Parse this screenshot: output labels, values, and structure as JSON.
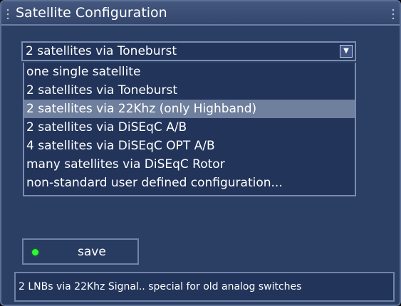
{
  "window": {
    "title": "Satellite Configuration"
  },
  "combo": {
    "selected_value": "2 satellites via Toneburst",
    "dropdown_icon": "triangle-down-icon",
    "options": [
      {
        "label": "one single satellite"
      },
      {
        "label": "2 satellites via Toneburst"
      },
      {
        "label": "2 satellites via 22Khz (only Highband)",
        "highlighted": true
      },
      {
        "label": "2 satellites via DiSEqC A/B"
      },
      {
        "label": "4 satellites via DiSEqC OPT A/B"
      },
      {
        "label": "many satellites via DiSEqC Rotor"
      },
      {
        "label": "non-standard user defined configuration..."
      }
    ]
  },
  "save_button": {
    "label": "save",
    "led_color": "#27ff27"
  },
  "status_bar": {
    "text": "2 LNBs via 22Khz Signal.. special for old analog switches"
  },
  "colors": {
    "background": "#2b3e63",
    "highlight": "#6f7f9e",
    "border": "#7a8cb0"
  }
}
